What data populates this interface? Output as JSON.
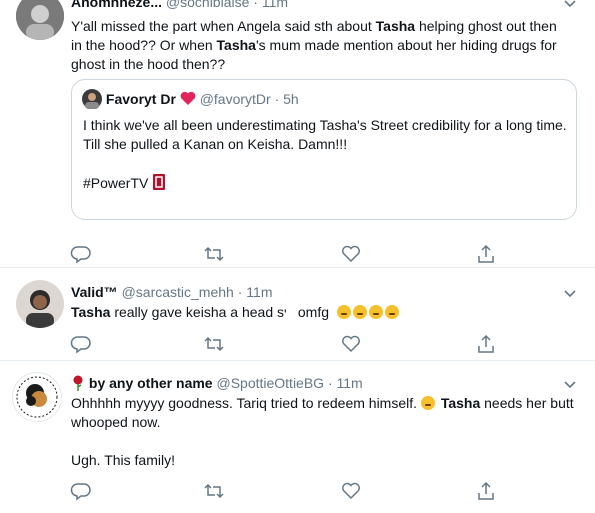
{
  "tweets": [
    {
      "display_name": "Anomhneze...",
      "handle": "@sochiblaise",
      "time": "· 11m",
      "text": [
        "Y'all missed the part when Angela said sth about ",
        "Tasha",
        " helping ghost out then in the hood?? Or when ",
        "Tasha",
        "'s mum made mention about her hiding drugs for ghost in the hood then??"
      ],
      "quote": {
        "display_name": "Favoryt Dr",
        "handle": "@favorytDr",
        "time": "· 5h",
        "line1": "I think we've all been underestimating Tasha's Street credibility for a long time.",
        "line2": "Till she pulled a Kanan on Keisha. Damn!!!",
        "hashtag": "#PowerTV"
      }
    },
    {
      "display_name": "Valid™",
      "handle": "@sarcastic_mehh",
      "time": "· 11m",
      "text": [
        "Tasha",
        " really gave keisha a head s",
        " omfg"
      ]
    },
    {
      "display_name": "by any other name",
      "handle": "@SpottieOttieBG",
      "time": "· 11m",
      "text": [
        "Ohhhhh myyyy goodness. Tariq tried to redeem himself. ",
        "Tasha",
        " needs her butt whooped now.",
        "Ugh. This family!"
      ]
    }
  ],
  "icons": {
    "reply": "reply-icon",
    "retweet": "retweet-icon",
    "like": "like-icon",
    "share": "share-icon",
    "caret": "chevron-down-icon"
  },
  "colors": {
    "muted": "#657786",
    "border": "#ccd6dd",
    "heart": "#e0245e",
    "rose": "#c0182a"
  }
}
